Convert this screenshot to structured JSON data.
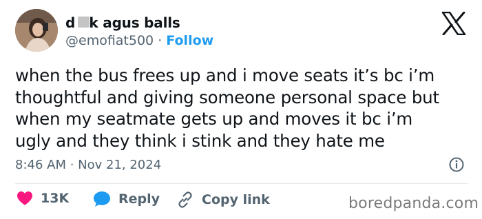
{
  "author": {
    "display_name": "d   k agus balls",
    "handle": "@emofiat500",
    "separator": "·",
    "follow_label": "Follow"
  },
  "tweet": {
    "lines": [
      "when the bus frees up and i move seats it’s bc i’m",
      "thoughtful and giving someone personal space but",
      "when my seatmate gets up and moves it bc i’m",
      "ugly and they think i stink and they hate me"
    ],
    "timestamp": "8:46 AM · Nov 21, 2024"
  },
  "actions": {
    "likes_count": "13K",
    "reply_label": "Reply",
    "copy_link_label": "Copy link"
  },
  "watermark": "boredpanda.com",
  "colors": {
    "like": "#f91880",
    "reply": "#1d9bf0",
    "follow": "#1d9bf0",
    "muted": "#536471"
  },
  "icons": {
    "brand": "x-logo-icon",
    "info": "info-icon",
    "like": "heart-icon",
    "reply": "speech-bubble-icon",
    "copy": "link-icon"
  }
}
